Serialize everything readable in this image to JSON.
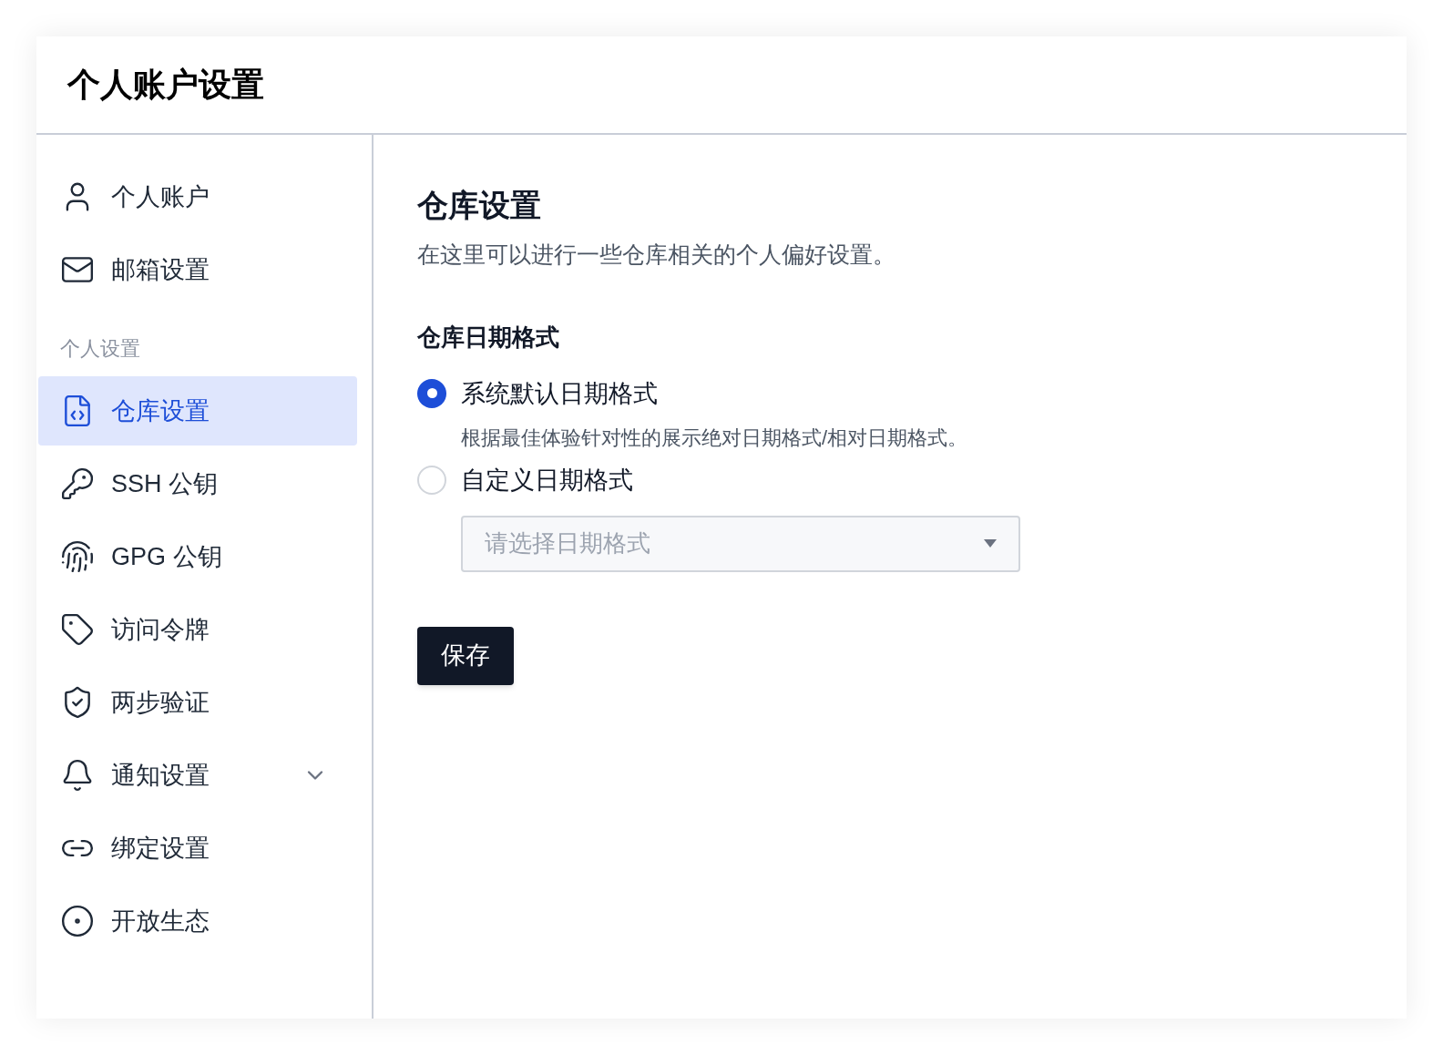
{
  "header": {
    "title": "个人账户设置"
  },
  "sidebar": {
    "items": [
      {
        "kind": "link",
        "label": "个人账户",
        "selected": false
      },
      {
        "kind": "link",
        "label": "邮箱设置",
        "selected": false
      },
      {
        "kind": "section",
        "label": "个人设置"
      },
      {
        "kind": "link",
        "label": "仓库设置",
        "selected": true
      },
      {
        "kind": "link",
        "label": "SSH 公钥",
        "selected": false
      },
      {
        "kind": "link",
        "label": "GPG 公钥",
        "selected": false
      },
      {
        "kind": "link",
        "label": "访问令牌",
        "selected": false
      },
      {
        "kind": "link",
        "label": "两步验证",
        "selected": false
      },
      {
        "kind": "link",
        "label": "通知设置",
        "selected": false,
        "expanded": false
      },
      {
        "kind": "link",
        "label": "绑定设置",
        "selected": false
      },
      {
        "kind": "link",
        "label": "开放生态",
        "selected": false
      }
    ]
  },
  "main": {
    "title": "仓库设置",
    "description": "在这里可以进行一些仓库相关的个人偏好设置。",
    "section_title": "仓库日期格式",
    "options": [
      {
        "label": "系统默认日期格式",
        "hint": "根据最佳体验针对性的展示绝对日期格式/相对日期格式。",
        "selected": true
      },
      {
        "label": "自定义日期格式",
        "selected": false
      }
    ],
    "select": {
      "placeholder": "请选择日期格式"
    },
    "save_button": "保存"
  }
}
